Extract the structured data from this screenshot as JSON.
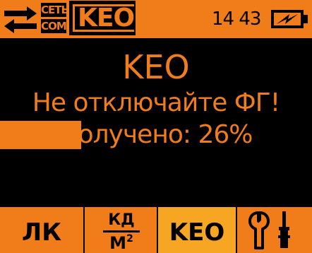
{
  "status_bar": {
    "tag_set": "СЕТЬ",
    "tag_com": "COM",
    "mode_badge": "KEO",
    "time": "14 43",
    "battery_icon": "battery-charging-icon",
    "arrows_icon": "transfer-arrows-icon"
  },
  "main": {
    "title": "KEO",
    "warning": "Не отключайте ФГ!",
    "progress_label": "Получено: 26%",
    "progress_fraction": 0.26
  },
  "tabs": [
    {
      "label": "ЛК"
    },
    {
      "numerator": "КД",
      "denominator": "М",
      "exponent": "2"
    },
    {
      "label": "KEO",
      "active": true
    },
    {
      "icon": "tools-icon"
    }
  ],
  "colors": {
    "accent": "#f07c1a",
    "active_tab": "#f6a623",
    "background": "#000000"
  }
}
